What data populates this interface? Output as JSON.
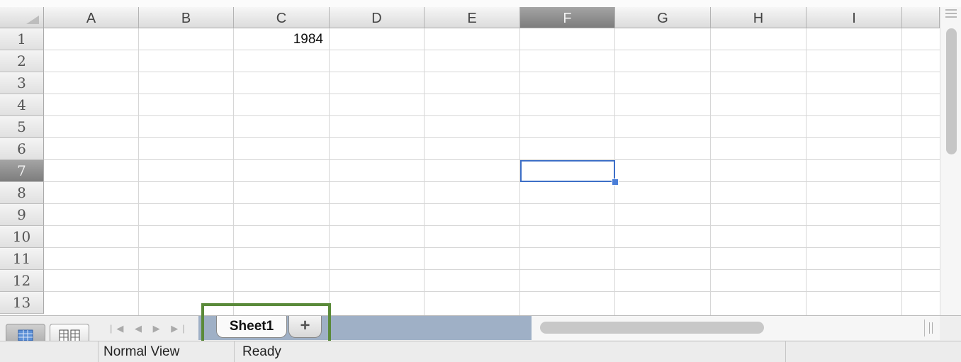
{
  "spreadsheet": {
    "columns": [
      "A",
      "B",
      "C",
      "D",
      "E",
      "F",
      "G",
      "H",
      "I"
    ],
    "rows": [
      "1",
      "2",
      "3",
      "4",
      "5",
      "6",
      "7",
      "8",
      "9",
      "10",
      "11",
      "12",
      "13"
    ],
    "selected_column": "F",
    "selected_row": "7",
    "cells": {
      "C1": "1984"
    },
    "active_cell": "F7"
  },
  "sheet_tabs": {
    "tabs": [
      {
        "label": "Sheet1"
      }
    ],
    "add_label": "+"
  },
  "status_bar": {
    "view_label": "Normal View",
    "status": "Ready"
  },
  "colors": {
    "selection_border": "#3d6fc7",
    "highlight_box": "#5a8a3a",
    "tab_band": "#9fb0c6"
  },
  "icons": {
    "normal_view": "grid-view-icon",
    "page_layout": "page-layout-icon",
    "sheet_nav": "sheet-nav-arrows-icon",
    "scroll_menu": "menu-lines-icon"
  }
}
